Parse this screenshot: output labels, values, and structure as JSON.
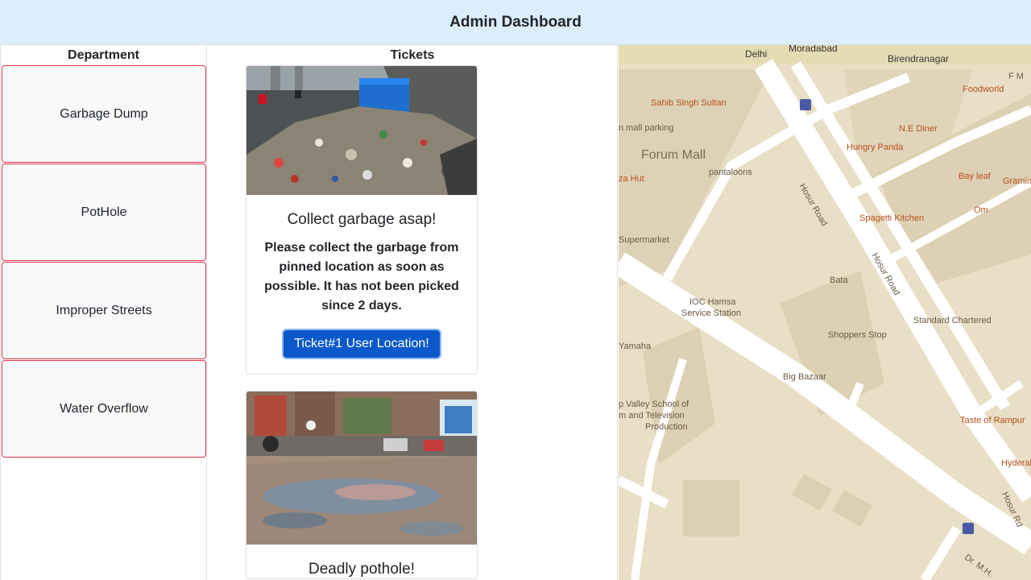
{
  "header": {
    "title": "Admin Dashboard"
  },
  "departments": {
    "title": "Department",
    "items": [
      {
        "label": "Garbage Dump"
      },
      {
        "label": "PotHole"
      },
      {
        "label": "Improper Streets"
      },
      {
        "label": "Water Overflow"
      }
    ]
  },
  "tickets": {
    "title": "Tickets",
    "items": [
      {
        "title": "Collect garbage asap!",
        "description": "Please collect the garbage from pinned location as soon as possible. It has not been picked since 2 days.",
        "button": "Ticket#1 User Location!"
      },
      {
        "title": "Deadly pothole!"
      }
    ]
  },
  "map": {
    "labels": {
      "delhi": "Delhi",
      "moradabad": "Moradabad",
      "birendranagar": "Birendranagar",
      "fm": "F M",
      "sahib": "Sahib Singh Sultan",
      "foodworld": "Foodworld",
      "mall_parking": "n mall parking",
      "ne_diner": "N.E Diner",
      "forum_mall": "Forum Mall",
      "hungry_panda": "Hungry Panda",
      "pizza_hut": "za Hut",
      "pantaloons": "pantaloons",
      "hosur1": "Hosur Road",
      "bay_leaf": "Bay leaf",
      "gramin": "Gramin",
      "spagetti": "Spagetti Kitchen",
      "om": "Om",
      "supermarket": "Supermarket",
      "hosur2": "Hosur Road",
      "bata": "Bata",
      "ioc1": "IOC Hamsa",
      "ioc2": "Service Station",
      "standard": "Standard Chartered",
      "yamaha": "Yamaha",
      "shoppers": "Shoppers Stop",
      "big_bazaar": "Big Bazaar",
      "school1": "p Valley School of",
      "school2": "m and Television",
      "school3": "Production",
      "rampur": "Taste of Rampur",
      "hyderabad": "Hyderabad",
      "hosur3": "Hosur Rd",
      "drm": "Dr. M.H."
    }
  }
}
